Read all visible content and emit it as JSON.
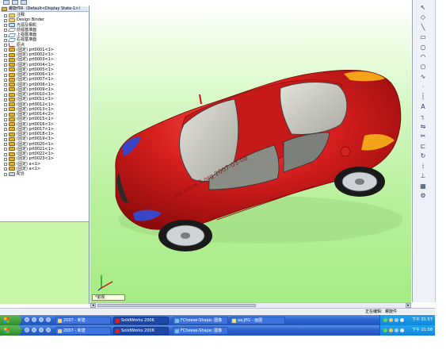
{
  "tree": {
    "header": "螺旋件R（Default<Display State-1>）",
    "items": [
      {
        "label": "注释",
        "icon": "annotations-folder-icon"
      },
      {
        "label": "Design Binder",
        "icon": "design-binder-icon"
      },
      {
        "label": "光源及相机",
        "icon": "lights-cameras-folder-icon"
      },
      {
        "label": "前视基准面",
        "icon": "front-plane-icon"
      },
      {
        "label": "上视基准面",
        "icon": "top-plane-icon"
      },
      {
        "label": "右视基准面",
        "icon": "right-plane-icon"
      },
      {
        "label": "原点",
        "icon": "origin-icon"
      },
      {
        "label": "(固定) prt0001<1>",
        "icon": "part-icon"
      },
      {
        "label": "(固定) prt0002<1>",
        "icon": "part-icon"
      },
      {
        "label": "(固定) prt0003<1>",
        "icon": "part-icon"
      },
      {
        "label": "(固定) prt0004<1>",
        "icon": "part-icon"
      },
      {
        "label": "(固定) prt0005<1>",
        "icon": "part-icon"
      },
      {
        "label": "(固定) prt0006<1>",
        "icon": "part-icon"
      },
      {
        "label": "(固定) prt0007<1>",
        "icon": "part-icon"
      },
      {
        "label": "(固定) prt0008<1>",
        "icon": "part-icon"
      },
      {
        "label": "(固定) prt0009<1>",
        "icon": "part-icon"
      },
      {
        "label": "(固定) prt0010<1>",
        "icon": "part-icon"
      },
      {
        "label": "(固定) prt0011<1>",
        "icon": "part-icon"
      },
      {
        "label": "(固定) prt0012<1>",
        "icon": "part-icon"
      },
      {
        "label": "(固定) prt0013<1>",
        "icon": "part-icon"
      },
      {
        "label": "(固定) prt0014<2>",
        "icon": "part-icon"
      },
      {
        "label": "(固定) prt0015<1>",
        "icon": "part-icon"
      },
      {
        "label": "(固定) prt0016<1>",
        "icon": "part-icon"
      },
      {
        "label": "(固定) prt0017<1>",
        "icon": "part-icon"
      },
      {
        "label": "(固定) prt0018<1>",
        "icon": "part-icon"
      },
      {
        "label": "(固定) prt0019<1>",
        "icon": "part-icon"
      },
      {
        "label": "(固定) prt0020<1>",
        "icon": "part-icon"
      },
      {
        "label": "(固定) prt0021<1>",
        "icon": "part-icon"
      },
      {
        "label": "(固定) prt0022<1>",
        "icon": "part-icon"
      },
      {
        "label": "(固定) prt0023<1>",
        "icon": "part-icon"
      },
      {
        "label": "(固定) a<1>",
        "icon": "part-icon"
      },
      {
        "label": "(固定) a<1>",
        "icon": "part-icon"
      },
      {
        "label": "配合",
        "icon": "mates-icon"
      }
    ]
  },
  "viewport": {
    "watermark": "by www.3.org 2007-03-08",
    "view_label": "*前视",
    "body_color": "#d81f1f",
    "glass_color": "#bfbfb7",
    "background_color": "#b9f09c"
  },
  "status_bar": {
    "text": "正在编辑：螺旋件"
  },
  "taskbars": [
    {
      "buttons": [
        {
          "label": "2007 - 新建",
          "icon": "folder-icon",
          "active": false
        },
        {
          "label": "SolidWorks 2006",
          "icon": "solidworks-icon",
          "active": true
        },
        {
          "label": "FCheese-Shape: 图像",
          "icon": "image-viewer-icon",
          "active": false
        },
        {
          "label": "aa.JPG - 画图",
          "icon": "paint-icon",
          "active": false
        }
      ],
      "clock": "下午 01:57"
    },
    {
      "buttons": [
        {
          "label": "2007 - 新建",
          "icon": "folder-icon",
          "active": false
        },
        {
          "label": "SolidWorks 2006",
          "icon": "solidworks-icon",
          "active": true
        },
        {
          "label": "FCheese-Shape: 图像",
          "icon": "image-viewer-icon",
          "active": false
        }
      ],
      "clock": "下午 01:58"
    }
  ],
  "right_toolbar": {
    "tools": [
      "pointer-icon",
      "smart-dimension-icon",
      "line-icon",
      "rectangle-icon",
      "circle-icon",
      "arc-icon",
      "polygon-icon",
      "spline-icon",
      "point-icon",
      "centerline-icon",
      "text-icon",
      "fillet-icon",
      "mirror-icon",
      "trim-icon",
      "offset-icon",
      "convert-icon",
      "pattern-icon",
      "relation-icon",
      "grid-icon",
      "settings-icon"
    ]
  }
}
